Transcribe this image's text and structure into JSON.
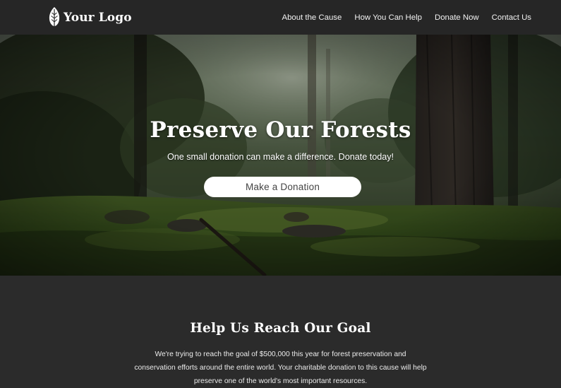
{
  "brand": {
    "logo_icon": "leaf-icon",
    "name": "Your Logo"
  },
  "nav": {
    "items": [
      {
        "label": "About the Cause"
      },
      {
        "label": "How You Can Help"
      },
      {
        "label": "Donate Now"
      },
      {
        "label": "Contact Us"
      }
    ]
  },
  "hero": {
    "background": "forest-photo",
    "title": "Preserve Our Forests",
    "subtitle": "One small donation can make a difference. Donate today!",
    "cta_label": "Make a Donation"
  },
  "goal": {
    "title": "Help Us Reach Our Goal",
    "text": "We're trying to reach the goal of $500,000 this year for forest preservation and conservation efforts around the entire world. Your charitable donation to this cause will help preserve one of the world's most important resources."
  },
  "colors": {
    "navbar_bg": "#262626",
    "section_bg": "#2b2b2b",
    "text": "#ffffff",
    "button_bg": "#ffffff",
    "button_text": "#444444"
  }
}
